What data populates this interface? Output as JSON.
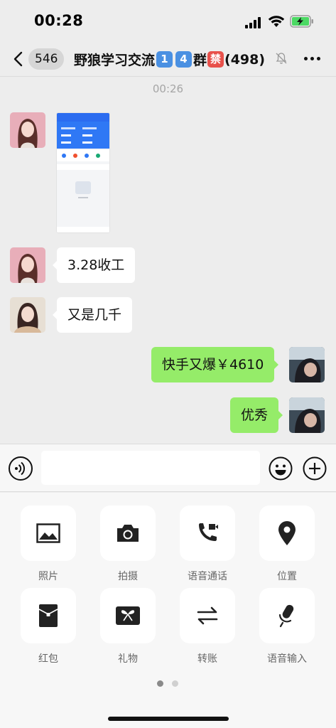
{
  "status_bar": {
    "time": "00:28",
    "signal_icon": "cellular-signal-icon",
    "wifi_icon": "wifi-icon",
    "battery_icon": "battery-charging-icon"
  },
  "nav": {
    "back_icon": "chevron-left-icon",
    "unread_count": "546",
    "title_prefix": "野狼学习交流",
    "title_keys": [
      "1",
      "4"
    ],
    "title_mid": "群",
    "title_ban": "禁",
    "title_suffix": "(498)",
    "mute_icon": "bell-muted-icon",
    "more_icon": "more-horizontal-icon"
  },
  "chat": {
    "timestamp": "00:26",
    "messages": [
      {
        "side": "left",
        "type": "image",
        "avatar": "avatar-woman-long-hair"
      },
      {
        "side": "left",
        "type": "text",
        "text": "3.28收工",
        "avatar": "avatar-woman-long-hair"
      },
      {
        "side": "left",
        "type": "text",
        "text": "又是几千",
        "avatar": "avatar-woman-beige-sweater"
      },
      {
        "side": "right",
        "type": "text",
        "text": "快手又爆￥4610",
        "avatar": "avatar-self"
      },
      {
        "side": "right",
        "type": "text",
        "text": "优秀",
        "avatar": "avatar-self"
      }
    ]
  },
  "input_bar": {
    "voice_icon": "voice-input-icon",
    "placeholder": "",
    "emoji_icon": "emoji-icon",
    "plus_icon": "plus-circle-icon"
  },
  "tools": [
    {
      "label": "照片",
      "icon": "photo-icon"
    },
    {
      "label": "拍摄",
      "icon": "camera-icon"
    },
    {
      "label": "语音通话",
      "icon": "voice-video-call-icon"
    },
    {
      "label": "位置",
      "icon": "location-pin-icon"
    },
    {
      "label": "红包",
      "icon": "red-envelope-icon"
    },
    {
      "label": "礼物",
      "icon": "gift-icon"
    },
    {
      "label": "转账",
      "icon": "transfer-icon"
    },
    {
      "label": "语音输入",
      "icon": "microphone-icon"
    }
  ],
  "pager": {
    "current_page": 1,
    "total_pages": 2
  },
  "colors": {
    "background": "#ededed",
    "sent_bubble": "#95ec69",
    "received_bubble": "#ffffff",
    "panel": "#f7f7f7"
  }
}
